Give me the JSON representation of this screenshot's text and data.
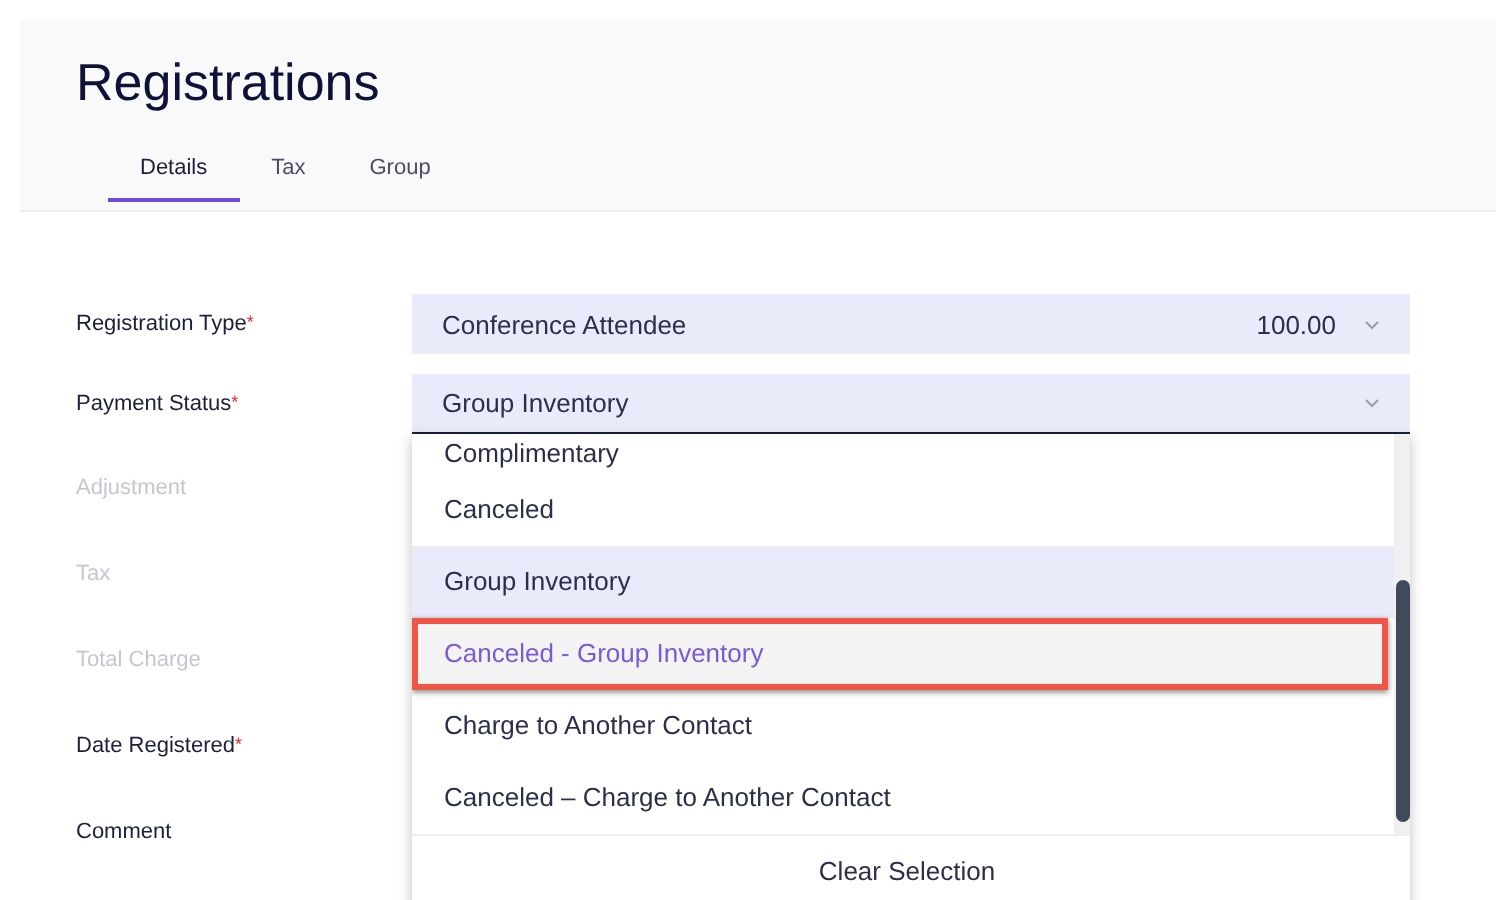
{
  "header": {
    "title": "Registrations"
  },
  "tabs": [
    {
      "label": "Details",
      "selected": true
    },
    {
      "label": "Tax",
      "selected": false
    },
    {
      "label": "Group",
      "selected": false
    }
  ],
  "fields": [
    {
      "label": "Registration Type",
      "required": "*",
      "disabled": false,
      "kind": "select",
      "value": "Conference Attendee",
      "amount": "100.00"
    },
    {
      "label": "Payment Status",
      "required": "*",
      "disabled": false,
      "kind": "select",
      "value": "Group Inventory",
      "open": true
    },
    {
      "label": "Adjustment",
      "disabled": true,
      "kind": "blank"
    },
    {
      "label": "Tax",
      "disabled": true,
      "kind": "blank"
    },
    {
      "label": "Total Charge",
      "disabled": true,
      "kind": "blank"
    },
    {
      "label": "Date Registered",
      "required": "*",
      "disabled": false,
      "kind": "blank"
    },
    {
      "label": "Comment",
      "disabled": false,
      "kind": "blank"
    }
  ],
  "dropdown": {
    "options": [
      {
        "label": "Complimentary",
        "selected": false,
        "highlighted": false
      },
      {
        "label": "Canceled",
        "selected": false,
        "highlighted": false
      },
      {
        "label": "Group Inventory",
        "selected": true,
        "highlighted": false
      },
      {
        "label": "Canceled - Group Inventory",
        "selected": false,
        "highlighted": true
      },
      {
        "label": "Charge to Another Contact",
        "selected": false,
        "highlighted": false
      },
      {
        "label": "Canceled – Charge to Another Contact",
        "selected": false,
        "highlighted": false
      }
    ],
    "footer": "Clear Selection"
  }
}
